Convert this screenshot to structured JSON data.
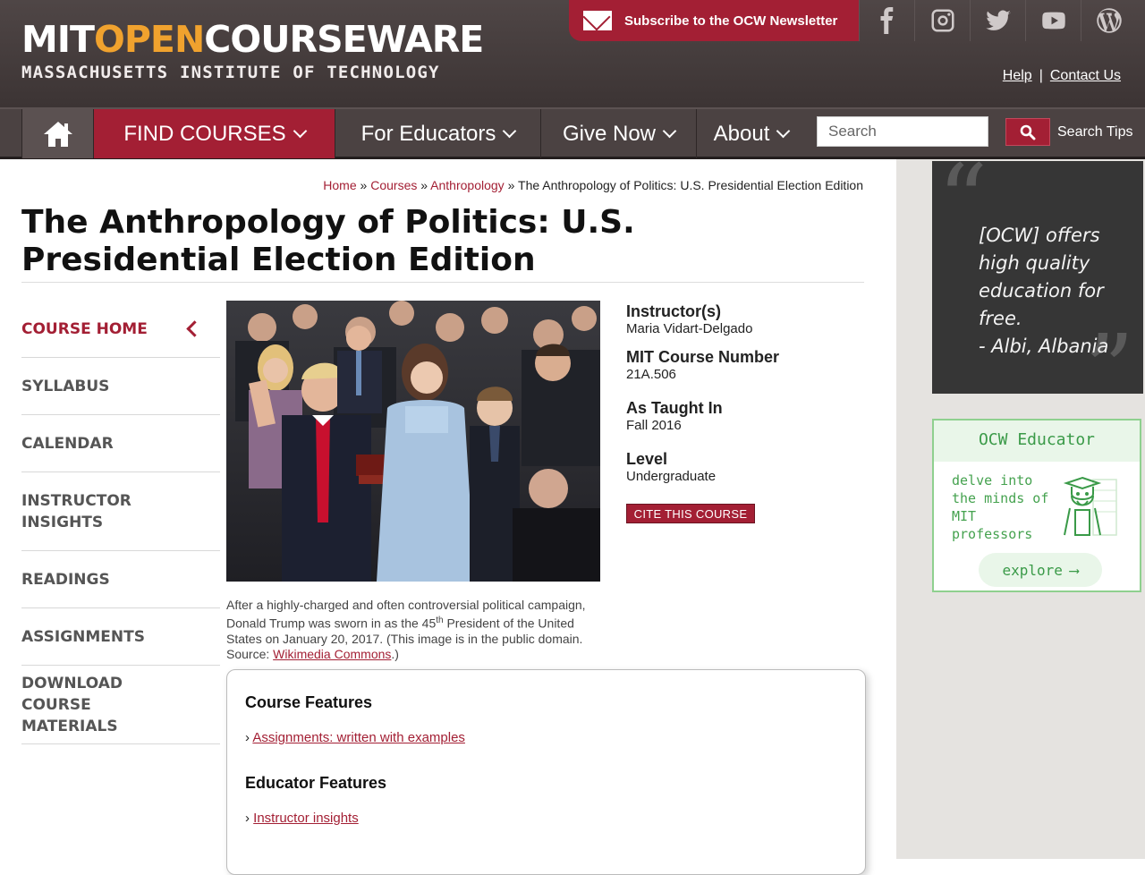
{
  "header": {
    "logo_mit": "MIT",
    "logo_open": "OPEN",
    "logo_courseware": "COURSEWARE",
    "logo_subtitle": "MASSACHUSETTS INSTITUTE OF TECHNOLOGY",
    "newsletter_label": "Subscribe to the OCW Newsletter",
    "help_link": "Help",
    "separator": "|",
    "contact_link": "Contact Us",
    "social_icons": [
      "facebook-icon",
      "instagram-icon",
      "twitter-icon",
      "youtube-icon",
      "wordpress-icon"
    ]
  },
  "nav": {
    "find_courses": "FIND COURSES",
    "for_educators": "For Educators",
    "give_now": "Give Now",
    "about": "About",
    "search_placeholder": "Search",
    "search_tips": "Search Tips"
  },
  "breadcrumb": {
    "home": "Home",
    "courses": "Courses",
    "department": "Anthropology",
    "separator": "»",
    "current": "The Anthropology of Politics: U.S. Presidential Election Edition"
  },
  "page_title": "The Anthropology of Politics: U.S. Presidential Election Edition",
  "course_nav": [
    {
      "label": "Course Home",
      "active": true
    },
    {
      "label": "Syllabus"
    },
    {
      "label": "Calendar"
    },
    {
      "label": "Instructor Insights"
    },
    {
      "label": "Readings"
    },
    {
      "label": "Assignments"
    },
    {
      "label": "Download Course Materials"
    }
  ],
  "image_caption": {
    "part1": "After a highly-charged and often controversial political campaign, Donald Trump was sworn in as the 45",
    "sup": "th",
    "part2": " President of the United States on January 20, 2017. (This image is in the public domain. Source: ",
    "link": "Wikimedia Commons",
    "part3": ".)"
  },
  "course_info": {
    "instructor_label": "Instructor(s)",
    "instructor_value": "Maria Vidart-Delgado",
    "number_label": "MIT Course Number",
    "number_value": "21A.506",
    "taught_label": "As Taught In",
    "taught_value": "Fall 2016",
    "level_label": "Level",
    "level_value": "Undergraduate",
    "cite_button": "CITE THIS COURSE"
  },
  "features": {
    "course_heading": "Course Features",
    "course_link": "Assignments: written with examples",
    "educator_heading": "Educator Features",
    "educator_link": "Instructor insights",
    "bullet": "›"
  },
  "sidebar": {
    "quote": "[OCW] offers high quality education for free.",
    "quote_author": "- Albi, Albania",
    "educator_title": "OCW Educator",
    "educator_text": "delve into the minds of MIT professors",
    "explore_button": "explore"
  },
  "colors": {
    "brand_red": "#a31f34",
    "header_bg": "#4b4242",
    "logo_orange": "#f0a22e",
    "educator_green": "#3a9a48"
  }
}
